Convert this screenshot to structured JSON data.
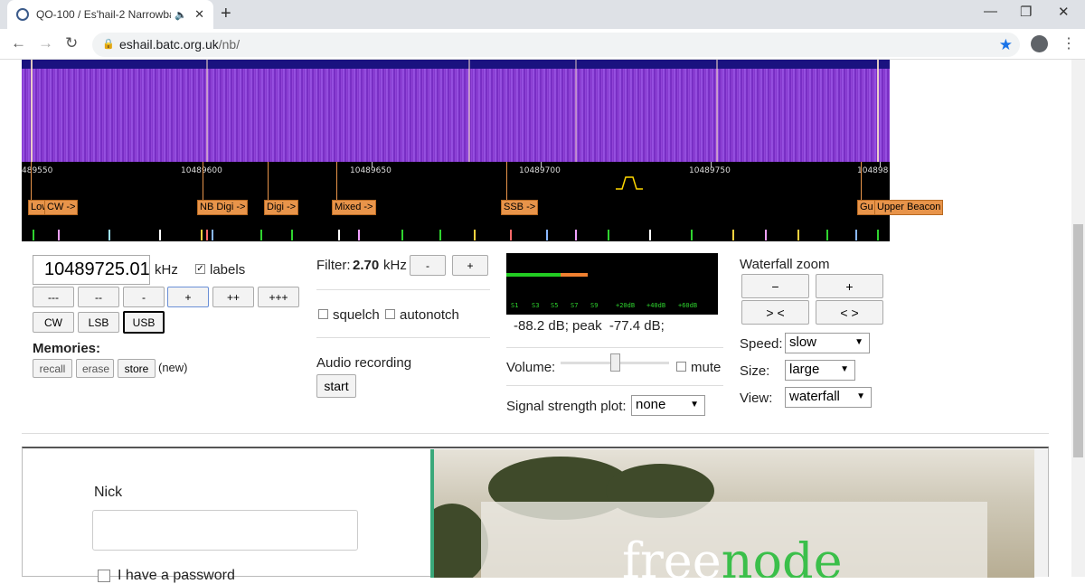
{
  "browser": {
    "tab_title": "QO-100 / Es'hail-2 Narrowba",
    "url_host": "eshail.batc.org.uk",
    "url_path": "/nb/"
  },
  "waterfall": {
    "tick_labels": [
      "489550",
      "10489600",
      "10489650",
      "10489700",
      "10489750",
      "104898"
    ],
    "band_labels": [
      "Low",
      "CW ->",
      "NB Digi ->",
      "Digi ->",
      "Mixed ->",
      "SSB ->",
      "Gu",
      "Upper Beacon"
    ]
  },
  "tuning": {
    "frequency": "10489725.01",
    "unit": "kHz",
    "labels_label": "labels",
    "step_buttons": [
      "---",
      "--",
      "-",
      "+",
      "++",
      "+++"
    ],
    "modes": [
      "CW",
      "LSB",
      "USB"
    ],
    "memories_label": "Memories:",
    "memory_buttons": [
      "recall",
      "erase",
      "store"
    ],
    "memory_status": "(new)"
  },
  "filter": {
    "label": "Filter:",
    "value": "2.70",
    "unit": "kHz",
    "minus": "-",
    "plus": "+",
    "squelch": "squelch",
    "autonotch": "autonotch",
    "audio_recording": "Audio recording",
    "start": "start"
  },
  "signal": {
    "meter_scale": [
      "S1",
      "S3",
      "S5",
      "S7",
      "S9",
      "+20dB",
      "+40dB",
      "+60dB"
    ],
    "reading": "-88.2 dB; peak  -77.4 dB;",
    "volume_label": "Volume:",
    "mute_label": "mute",
    "plot_label": "Signal strength plot:",
    "plot_value": "none"
  },
  "zoom": {
    "title": "Waterfall zoom",
    "buttons": [
      "−",
      "+",
      "> <",
      "< >"
    ],
    "speed_label": "Speed:",
    "speed_value": "slow",
    "size_label": "Size:",
    "size_value": "large",
    "view_label": "View:",
    "view_value": "waterfall"
  },
  "chat": {
    "nick_label": "Nick",
    "password_label": "I have a password",
    "logo_text_1": "free",
    "logo_text_2": "node"
  }
}
